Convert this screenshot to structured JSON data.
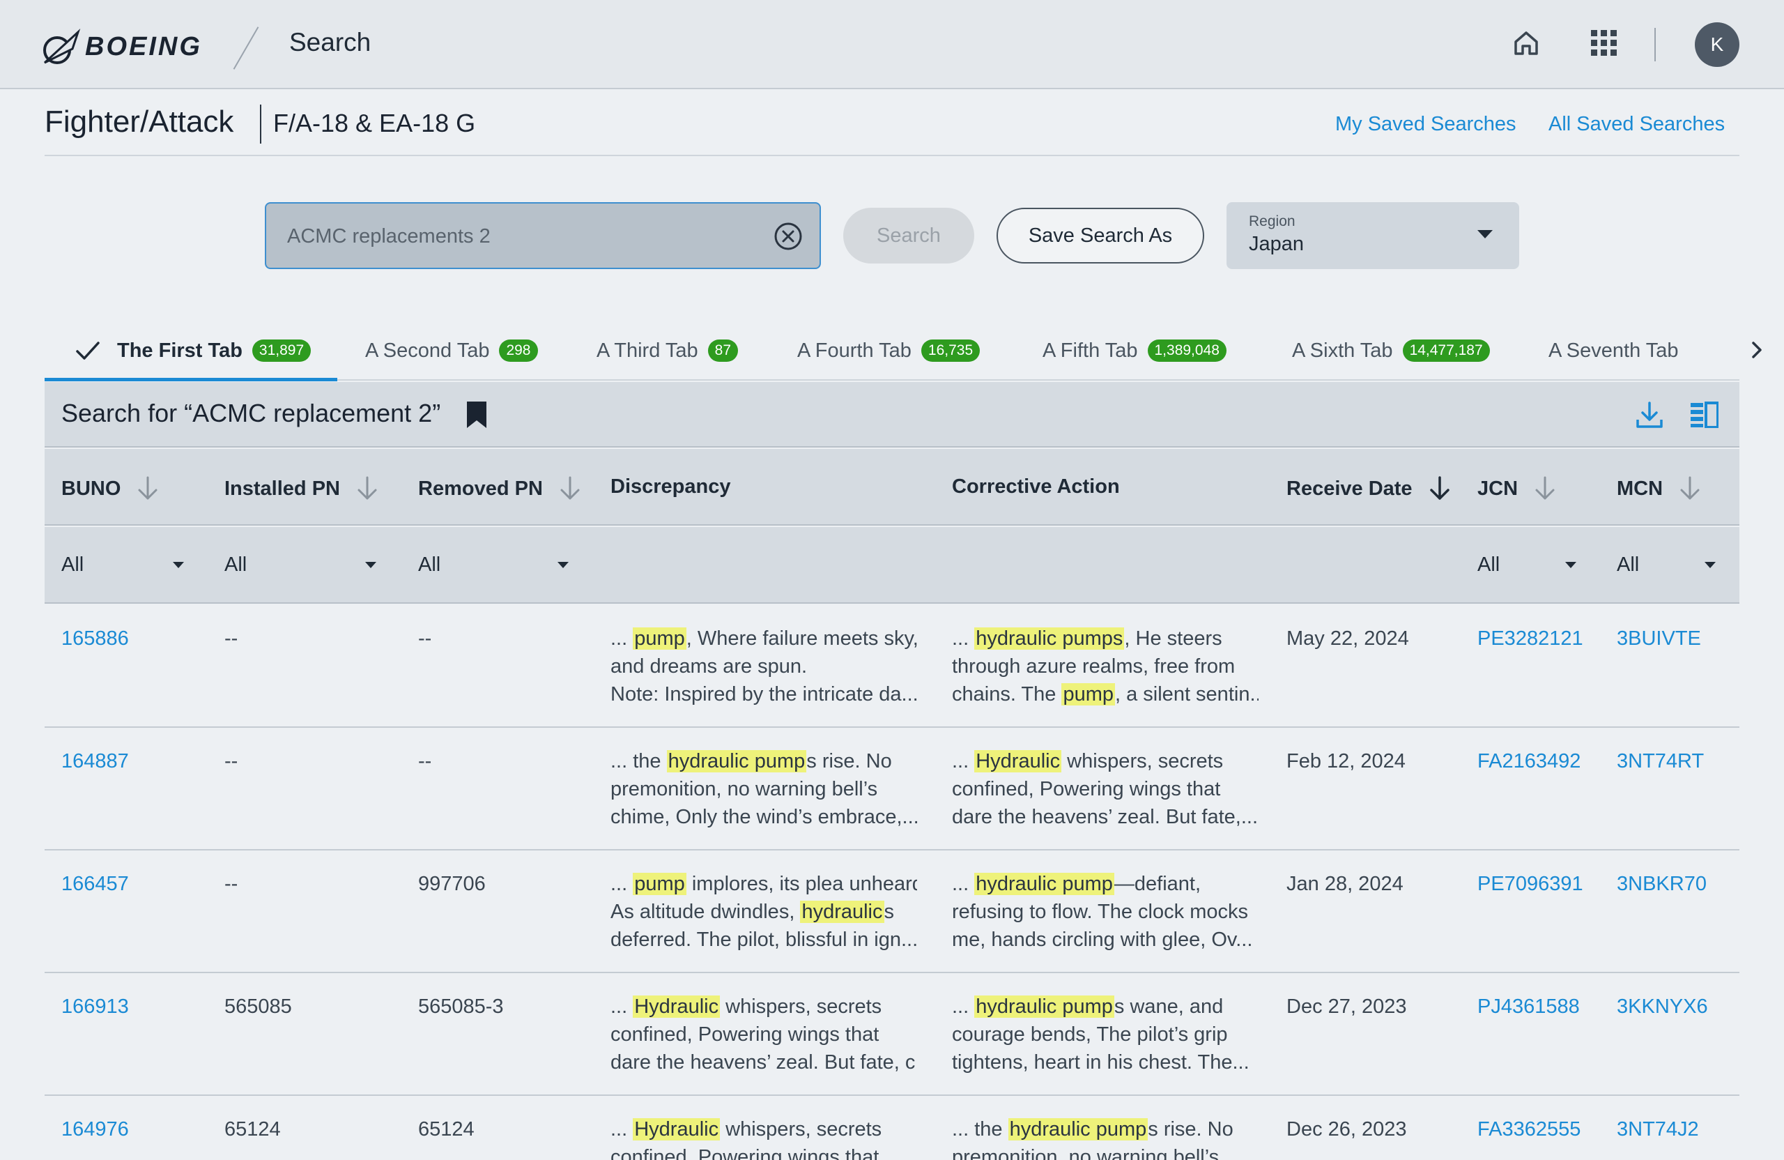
{
  "topbar": {
    "logo_text": "BOEING",
    "app_title": "Search",
    "avatar_initial": "K"
  },
  "page": {
    "title": "Fighter/Attack",
    "subtitle": "F/A-18 & EA-18 G",
    "links": {
      "my_saved": "My Saved Searches",
      "all_saved": "All Saved Searches"
    }
  },
  "search": {
    "value": "ACMC replacements 2",
    "search_label": "Search",
    "save_label": "Save Search As",
    "region_label": "Region",
    "region_value": "Japan"
  },
  "tabs": [
    {
      "label": "The First Tab",
      "count": "31,897",
      "active": true
    },
    {
      "label": "A Second Tab",
      "count": "298"
    },
    {
      "label": "A Third Tab",
      "count": "87"
    },
    {
      "label": "A Fourth Tab",
      "count": "16,735"
    },
    {
      "label": "A Fifth Tab",
      "count": "1,389,048"
    },
    {
      "label": "A Sixth Tab",
      "count": "14,477,187"
    },
    {
      "label": "A Seventh Tab"
    }
  ],
  "results": {
    "title": "Search for “ACMC replacement 2”",
    "columns": [
      "BUNO",
      "Installed PN",
      "Removed PN",
      "Discrepancy",
      "Corrective Action",
      "Receive Date",
      "JCN",
      "MCN"
    ],
    "filter_default": "All",
    "rows": [
      {
        "buno": "165886",
        "installed": "--",
        "removed": "--",
        "disc": [
          [
            "... ",
            "pump",
            ", Where failure meets sky,"
          ],
          [
            "and dreams are spun."
          ],
          [
            "Note: Inspired by the intricate da..."
          ]
        ],
        "corr": [
          [
            "... ",
            "hydraulic pumps",
            ", He steers"
          ],
          [
            "through azure realms, free from"
          ],
          [
            "chains. The ",
            "pump",
            ", a silent sentin..."
          ]
        ],
        "date": "May 22, 2024",
        "jcn": "PE3282121",
        "mcn": "3BUIVTE"
      },
      {
        "buno": "164887",
        "installed": "--",
        "removed": "--",
        "disc": [
          [
            "... the ",
            "hydraulic pump",
            "s rise. No"
          ],
          [
            "premonition, no warning bell’s"
          ],
          [
            "chime, Only the wind’s embrace,..."
          ]
        ],
        "corr": [
          [
            "... ",
            "Hydraulic",
            " whispers, secrets"
          ],
          [
            "confined, Powering wings that"
          ],
          [
            "dare the heavens’ zeal. But fate,..."
          ]
        ],
        "date": "Feb 12, 2024",
        "jcn": "FA2163492",
        "mcn": "3NT74RT"
      },
      {
        "buno": "166457",
        "installed": "--",
        "removed": "997706",
        "disc": [
          [
            "... ",
            "pump",
            " implores, its plea unheard,"
          ],
          [
            "As altitude dwindles, ",
            "hydraulic",
            "s"
          ],
          [
            "deferred. The pilot, blissful in ign..."
          ]
        ],
        "corr": [
          [
            "... ",
            "hydraulic pump",
            "—defiant,"
          ],
          [
            "refusing to flow. The clock mocks"
          ],
          [
            "me, hands circling with glee, Ov..."
          ]
        ],
        "date": "Jan 28, 2024",
        "jcn": "PE7096391",
        "mcn": "3NBKR70"
      },
      {
        "buno": "166913",
        "installed": "565085",
        "removed": "565085-3",
        "disc": [
          [
            "... ",
            "Hydraulic",
            " whispers, secrets"
          ],
          [
            "confined, Powering wings that"
          ],
          [
            "dare the heavens’ zeal. But fate, c..."
          ]
        ],
        "corr": [
          [
            "... ",
            "hydraulic pump",
            "s wane, and"
          ],
          [
            "courage bends, The pilot’s grip"
          ],
          [
            "tightens, heart in his chest. The..."
          ]
        ],
        "date": "Dec 27, 2023",
        "jcn": "PJ4361588",
        "mcn": "3KKNYX6"
      },
      {
        "buno": "164976",
        "installed": "65124",
        "removed": "65124",
        "disc": [
          [
            "... ",
            "Hydraulic",
            " whispers, secrets"
          ],
          [
            "confined, Powering wings that"
          ]
        ],
        "corr": [
          [
            "... the ",
            "hydraulic pump",
            "s rise. No"
          ],
          [
            "premonition, no warning bell’s"
          ]
        ],
        "date": "Dec 26, 2023",
        "jcn": "FA3362555",
        "mcn": "3NT74J2"
      }
    ]
  },
  "colors": {
    "accent": "#1a8ad4",
    "badge": "#2e9b1f",
    "highlight": "#eef27a"
  }
}
